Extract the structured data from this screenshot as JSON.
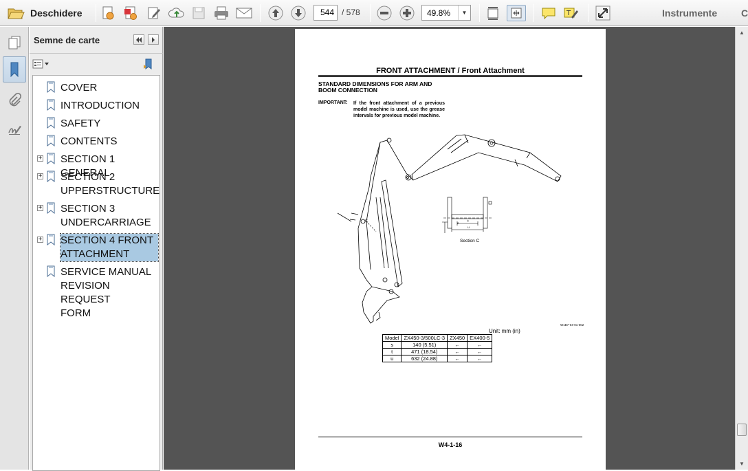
{
  "toolbar": {
    "open_label": "Deschidere",
    "page_current": "544",
    "page_total": "/ 578",
    "zoom_value": "49.8%",
    "tools_label": "Instrumente",
    "comment_label": "C"
  },
  "panel": {
    "title": "Semne de carte"
  },
  "bookmarks": [
    {
      "line1": "COVER",
      "line2": "",
      "line3": ""
    },
    {
      "line1": "INTRODUCTION",
      "line2": "",
      "line3": ""
    },
    {
      "line1": "SAFETY",
      "line2": "",
      "line3": ""
    },
    {
      "line1": "CONTENTS",
      "line2": "",
      "line3": ""
    },
    {
      "line1": "SECTION 1 GENERAL",
      "line2": "",
      "line3": ""
    },
    {
      "line1": "SECTION 2",
      "line2": "UPPERSTRUCTURE",
      "line3": ""
    },
    {
      "line1": "SECTION 3",
      "line2": "UNDERCARRIAGE",
      "line3": ""
    },
    {
      "line1": "SECTION 4 FRONT",
      "line2": "ATTACHMENT",
      "line3": ""
    },
    {
      "line1": "SERVICE MANUAL",
      "line2": "REVISION REQUEST",
      "line3": "FORM"
    }
  ],
  "document": {
    "header": "FRONT ATTACHMENT / Front Attachment",
    "subhead": "STANDARD DIMENSIONS FOR ARM AND BOOM CONNECTION",
    "important_label": "IMPORTANT:",
    "important_text": "If the front attachment of a previous model machine is used, use the grease intervals for previous model machine.",
    "section_caption": "Section C",
    "figure_code": "W1B7-04-01-002",
    "unit_note": "Unit: mm (in)",
    "table": {
      "headers": [
        "Model",
        "ZX450-3/500LC-3",
        "ZX450",
        "EX400-5"
      ],
      "rows": [
        [
          "s",
          "140 (5.51)",
          "←",
          "←"
        ],
        [
          "t",
          "471 (18.54)",
          "←",
          "←"
        ],
        [
          "u",
          "632 (24.88)",
          "←",
          "←"
        ]
      ]
    },
    "footer": "W4-1-16",
    "labels": {
      "c": "C",
      "s": "s",
      "t": "t",
      "u": "u"
    }
  }
}
